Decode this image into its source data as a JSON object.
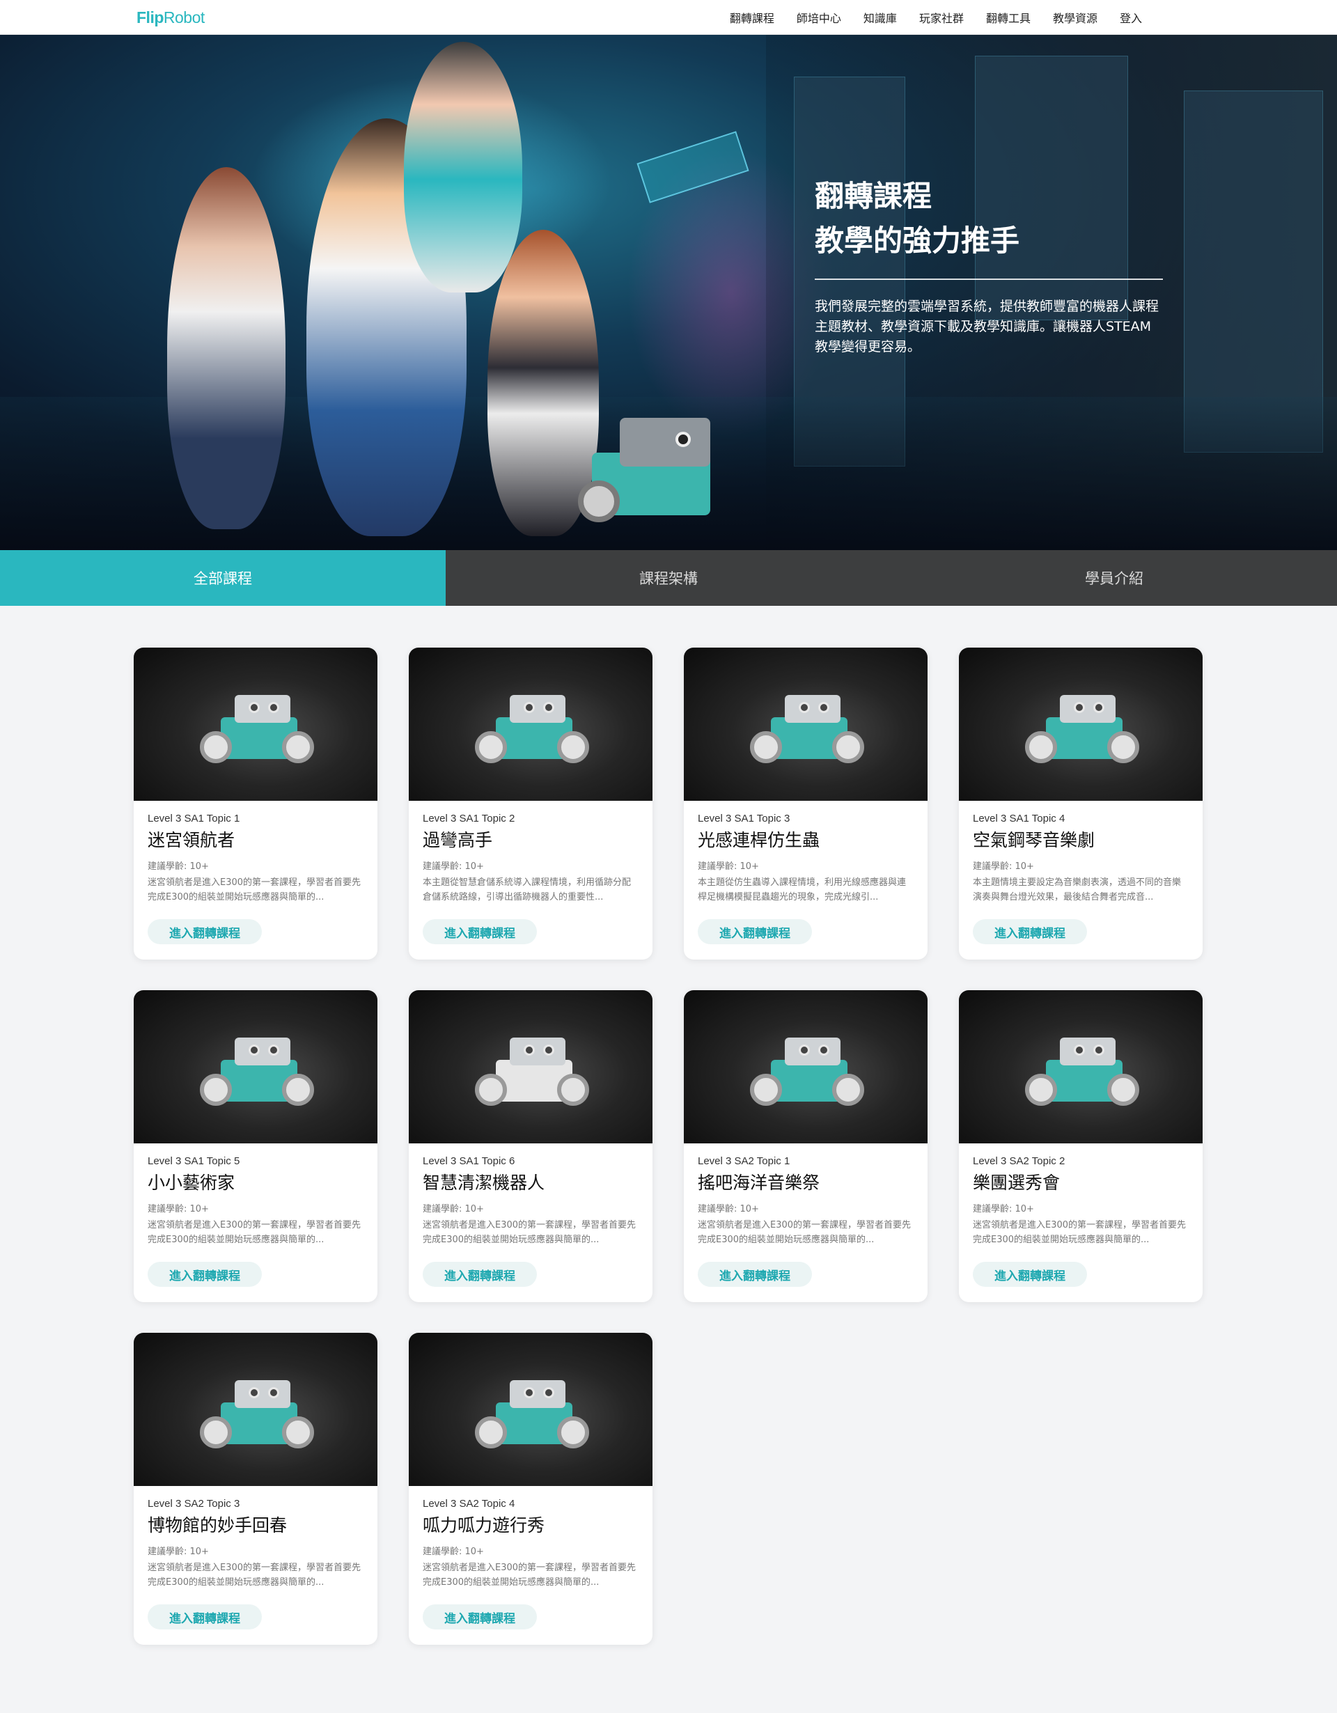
{
  "brand": {
    "logo_a": "Fl",
    "logo_b": "i",
    "logo_c": "p",
    "logo_d": "Robot",
    "accent": "#2ab7bf"
  },
  "nav": [
    "翻轉課程",
    "師培中心",
    "知識庫",
    "玩家社群",
    "翻轉工具",
    "教學資源",
    "登入"
  ],
  "hero": {
    "title_line1": "翻轉課程",
    "title_line2": "教學的強力推手",
    "description": "我們發展完整的雲端學習系統，提供教師豐富的機器人課程主題教材、教學資源下載及教學知識庫。讓機器人STEAM教學變得更容易。"
  },
  "tabs": [
    {
      "label": "全部課程",
      "active": true
    },
    {
      "label": "課程架構",
      "active": false
    },
    {
      "label": "學員介紹",
      "active": false
    }
  ],
  "courses": [
    {
      "level": "Level 3 SA1 Topic 1",
      "title": "迷宮領航者",
      "age": "建議學齡: 10+",
      "desc": "迷宮領航者是進入E300的第一套課程，學習者首要先完成E300的組裝並開始玩感應器與簡單的...",
      "button": "進入翻轉課程"
    },
    {
      "level": "Level 3 SA1 Topic 2",
      "title": "過彎高手",
      "age": "建議學齡: 10+",
      "desc": "本主題從智慧倉儲系統導入課程情境，利用循跡分配倉儲系統路線，引導出循跡機器人的重要性...",
      "button": "進入翻轉課程"
    },
    {
      "level": "Level 3 SA1 Topic 3",
      "title": "光感連桿仿生蟲",
      "age": "建議學齡: 10+",
      "desc": "本主題從仿生蟲導入課程情境，利用光線感應器與連桿足機構模擬昆蟲趨光的現象，完成光線引...",
      "button": "進入翻轉課程"
    },
    {
      "level": "Level 3 SA1 Topic 4",
      "title": "空氣鋼琴音樂劇",
      "age": "建議學齡: 10+",
      "desc": "本主題情境主要設定為音樂劇表演，透過不同的音樂演奏與舞台燈光效果，最後結合舞者完成音...",
      "button": "進入翻轉課程"
    },
    {
      "level": "Level 3 SA1 Topic 5",
      "title": "小小藝術家",
      "age": "建議學齡: 10+",
      "desc": "迷宮領航者是進入E300的第一套課程，學習者首要先完成E300的組裝並開始玩感應器與簡單的...",
      "button": "進入翻轉課程"
    },
    {
      "level": "Level 3 SA1 Topic 6",
      "title": "智慧清潔機器人",
      "age": "建議學齡: 10+",
      "desc": "迷宮領航者是進入E300的第一套課程，學習者首要先完成E300的組裝並開始玩感應器與簡單的...",
      "button": "進入翻轉課程"
    },
    {
      "level": "Level 3 SA2 Topic 1",
      "title": "搖吧海洋音樂祭",
      "age": "建議學齡: 10+",
      "desc": "迷宮領航者是進入E300的第一套課程，學習者首要先完成E300的組裝並開始玩感應器與簡單的...",
      "button": "進入翻轉課程"
    },
    {
      "level": "Level 3 SA2 Topic 2",
      "title": "樂團選秀會",
      "age": "建議學齡: 10+",
      "desc": "迷宮領航者是進入E300的第一套課程，學習者首要先完成E300的組裝並開始玩感應器與簡單的...",
      "button": "進入翻轉課程"
    },
    {
      "level": "Level 3 SA2 Topic 3",
      "title": "博物館的妙手回春",
      "age": "建議學齡: 10+",
      "desc": "迷宮領航者是進入E300的第一套課程，學習者首要先完成E300的組裝並開始玩感應器與簡單的...",
      "button": "進入翻轉課程"
    },
    {
      "level": "Level 3 SA2 Topic 4",
      "title": "呱力呱力遊行秀",
      "age": "建議學齡: 10+",
      "desc": "迷宮領航者是進入E300的第一套課程，學習者首要先完成E300的組裝並開始玩感應器與簡單的...",
      "button": "進入翻轉課程"
    }
  ]
}
